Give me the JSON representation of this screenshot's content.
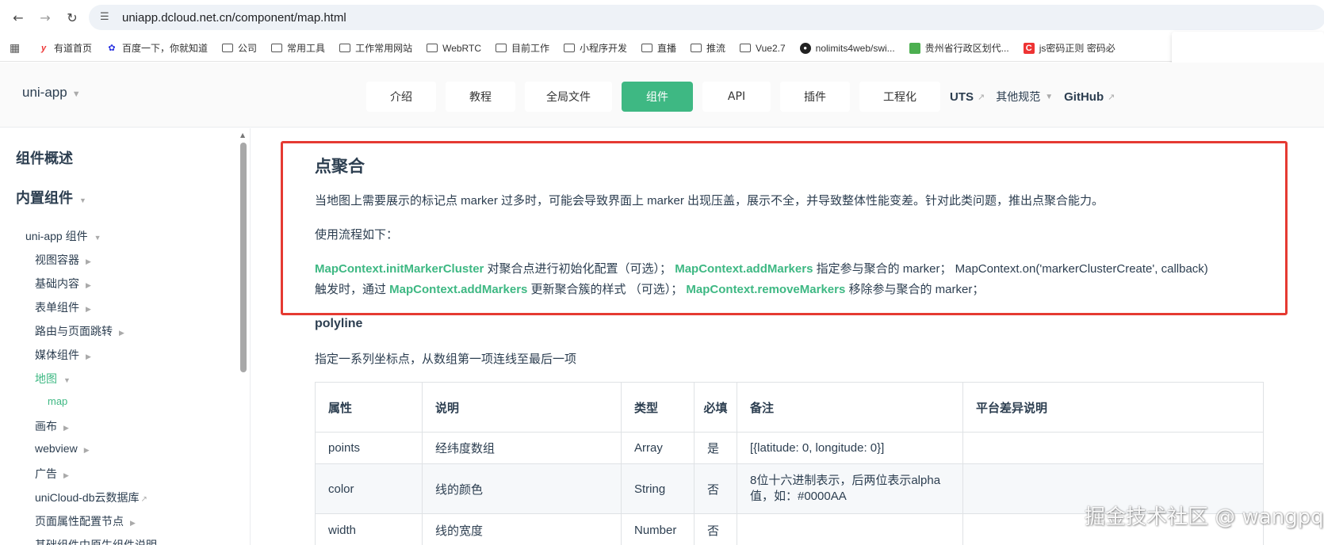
{
  "browser": {
    "url": "uniapp.dcloud.net.cn/component/map.html",
    "bookmarks": [
      {
        "label": "有道首页",
        "icon": "youdao-icon"
      },
      {
        "label": "百度一下，你就知道",
        "icon": "baidu-icon"
      },
      {
        "label": "公司",
        "icon": "folder-icon"
      },
      {
        "label": "常用工具",
        "icon": "folder-icon"
      },
      {
        "label": "工作常用网站",
        "icon": "folder-icon"
      },
      {
        "label": "WebRTC",
        "icon": "folder-icon"
      },
      {
        "label": "目前工作",
        "icon": "folder-icon"
      },
      {
        "label": "小程序开发",
        "icon": "folder-icon"
      },
      {
        "label": "直播",
        "icon": "folder-icon"
      },
      {
        "label": "推流",
        "icon": "folder-icon"
      },
      {
        "label": "Vue2.7",
        "icon": "folder-icon"
      },
      {
        "label": "nolimits4web/swi...",
        "icon": "github-icon"
      },
      {
        "label": "贵州省行政区划代...",
        "icon": "map-icon"
      },
      {
        "label": "js密码正则 密码必",
        "icon": "c-red-icon"
      }
    ]
  },
  "header": {
    "brand": "uni-app",
    "nav": [
      {
        "label": "介绍",
        "active": false
      },
      {
        "label": "教程",
        "active": false
      },
      {
        "label": "全局文件",
        "active": false
      },
      {
        "label": "组件",
        "active": true
      },
      {
        "label": "API",
        "active": false
      },
      {
        "label": "插件",
        "active": false
      },
      {
        "label": "工程化",
        "active": false
      }
    ],
    "uts": "UTS",
    "other_specs": "其他规范",
    "github": "GitHub"
  },
  "sidebar": {
    "overview": "组件概述",
    "builtin": "内置组件",
    "uniapp_components": "uni-app 组件",
    "items": [
      {
        "label": "视图容器"
      },
      {
        "label": "基础内容"
      },
      {
        "label": "表单组件"
      },
      {
        "label": "路由与页面跳转"
      },
      {
        "label": "媒体组件"
      },
      {
        "label": "地图"
      },
      {
        "label": "map"
      },
      {
        "label": "画布"
      },
      {
        "label": "webview"
      },
      {
        "label": "广告"
      },
      {
        "label": "uniCloud-db云数据库"
      },
      {
        "label": "页面属性配置节点"
      },
      {
        "label": "基础组件中原生组件说明"
      }
    ]
  },
  "content": {
    "cluster_title": "点聚合",
    "cluster_desc": "当地图上需要展示的标记点 marker 过多时，可能会导致界面上 marker 出现压盖，展示不全，并导致整体性能变差。针对此类问题，推出点聚合能力。",
    "flow_label": "使用流程如下：",
    "flow_line1": {
      "link1": "MapContext.initMarkerCluster",
      "text1": " 对聚合点进行初始化配置（可选）；  ",
      "link2": "MapContext.addMarkers",
      "text2": " 指定参与聚合的 marker；  MapContext.on('markerClusterCreate', callback)"
    },
    "flow_line2": {
      "text0": "触发时，通过 ",
      "link1": "MapContext.addMarkers",
      "text1": " 更新聚合簇的样式 （可选）；  ",
      "link2": "MapContext.removeMarkers",
      "text2": " 移除参与聚合的 marker；"
    },
    "polyline_title": "polyline",
    "polyline_desc": "指定一系列坐标点，从数组第一项连线至最后一项",
    "table": {
      "headers": [
        "属性",
        "说明",
        "类型",
        "必填",
        "备注",
        "平台差异说明"
      ],
      "rows": [
        [
          "points",
          "经纬度数组",
          "Array",
          "是",
          "[{latitude: 0, longitude: 0}]",
          ""
        ],
        [
          "color",
          "线的颜色",
          "String",
          "否",
          "8位十六进制表示，后两位表示alpha值，如：#0000AA",
          ""
        ],
        [
          "width",
          "线的宽度",
          "Number",
          "否",
          "",
          ""
        ]
      ]
    }
  },
  "watermark": "掘金技术社区 @ wangpq",
  "colors": {
    "accent": "#3eb883",
    "highlight_border": "#e53a32"
  }
}
